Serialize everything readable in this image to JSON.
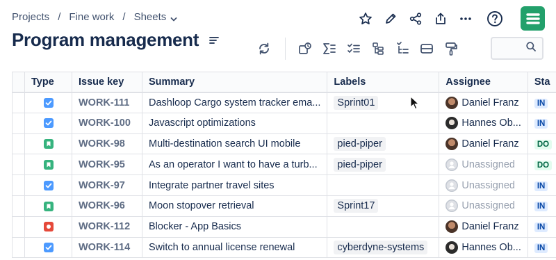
{
  "breadcrumb": {
    "items": [
      "Projects",
      "Fine work",
      "Sheets"
    ],
    "separator": "/"
  },
  "page": {
    "title": "Program management"
  },
  "top_actions": [
    "star-icon",
    "edit-icon",
    "share-icon",
    "export-icon",
    "more-icon",
    "help-icon"
  ],
  "toolbar": [
    "refresh-icon",
    "issue-status-icon",
    "sum-icon",
    "checklist-icon",
    "hierarchy-icon",
    "tree-icon",
    "card-layout-icon",
    "paint-roller-icon"
  ],
  "search": {
    "placeholder": ""
  },
  "colors": {
    "task": "#4c9aff",
    "story": "#36b37e",
    "bug": "#e5493a",
    "logo": "#22a06b"
  },
  "table": {
    "headers": [
      "Type",
      "Issue key",
      "Summary",
      "Labels",
      "Assignee",
      "Sta"
    ],
    "rows": [
      {
        "type": "task",
        "key": "WORK-111",
        "summary": "Dashloop Cargo system tracker ema...",
        "label": "Sprint01",
        "assignee": "Daniel Franz",
        "avatar": "df",
        "status": "IN",
        "status_kind": "inp"
      },
      {
        "type": "task",
        "key": "WORK-100",
        "summary": "Javascript optimizations",
        "label": "",
        "assignee": "Hannes Ob...",
        "avatar": "ho",
        "status": "IN",
        "status_kind": "inp"
      },
      {
        "type": "story",
        "key": "WORK-98",
        "summary": "Multi-destination search UI mobile",
        "label": "pied-piper",
        "assignee": "Daniel Franz",
        "avatar": "df",
        "status": "DO",
        "status_kind": "done"
      },
      {
        "type": "story",
        "key": "WORK-95",
        "summary": "As an operator I want to have a turb...",
        "label": "pied-piper",
        "assignee": "Unassigned",
        "avatar": "un",
        "status": "DO",
        "status_kind": "done"
      },
      {
        "type": "task",
        "key": "WORK-97",
        "summary": "Integrate partner travel sites",
        "label": "",
        "assignee": "Unassigned",
        "avatar": "un",
        "status": "IN",
        "status_kind": "inp"
      },
      {
        "type": "story",
        "key": "WORK-96",
        "summary": "Moon stopover retrieval",
        "label": "Sprint17",
        "assignee": "Unassigned",
        "avatar": "un",
        "status": "IN",
        "status_kind": "inp"
      },
      {
        "type": "bug",
        "key": "WORK-112",
        "summary": "Blocker - App Basics",
        "label": "",
        "assignee": "Daniel Franz",
        "avatar": "df",
        "status": "IN",
        "status_kind": "inp"
      },
      {
        "type": "task",
        "key": "WORK-114",
        "summary": "Switch to annual license renewal",
        "label": "cyberdyne-systems",
        "assignee": "Hannes Ob...",
        "avatar": "ho",
        "status": "IN",
        "status_kind": "inp"
      }
    ]
  }
}
